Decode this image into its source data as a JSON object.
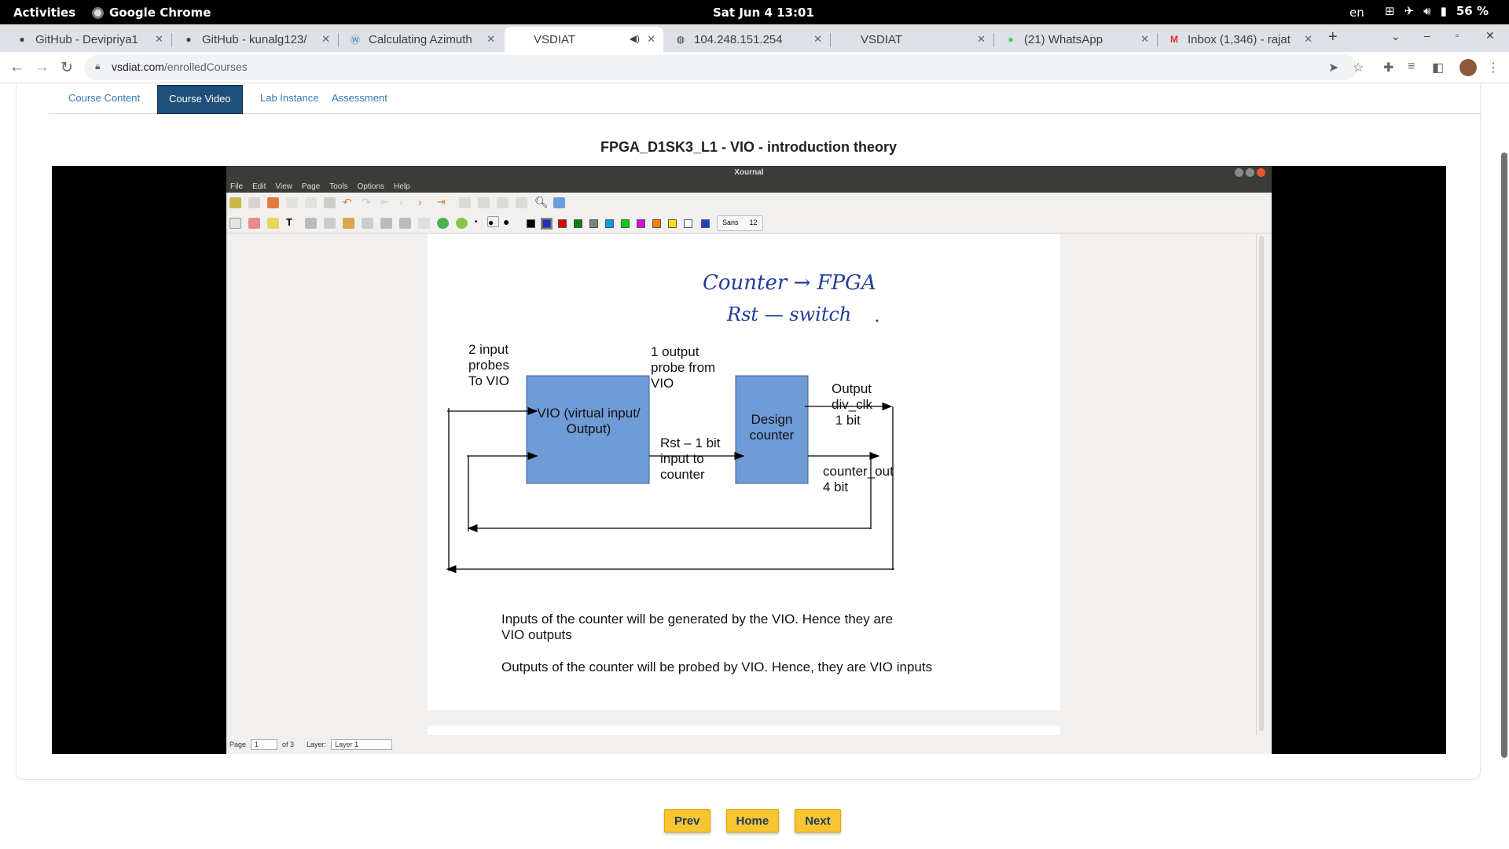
{
  "gnome": {
    "activities": "Activities",
    "app_name": "Google Chrome",
    "clock": "Sat Jun 4  13:01",
    "lang": "en",
    "battery": "56 %"
  },
  "tabs": [
    {
      "title": "GitHub - Devipriya1",
      "icon": "github-icon"
    },
    {
      "title": "GitHub - kunalg123/",
      "icon": "github-icon"
    },
    {
      "title": "Calculating Azimuth",
      "icon": "wordpress-icon"
    },
    {
      "title": "VSDIAT",
      "icon": "page-icon",
      "active": true
    },
    {
      "title": "104.248.151.254",
      "icon": "globe-icon"
    },
    {
      "title": "VSDIAT",
      "icon": "page-icon"
    },
    {
      "title": "(21) WhatsApp",
      "icon": "whatsapp-icon"
    },
    {
      "title": "Inbox (1,346) - rajat",
      "icon": "gmail-icon"
    }
  ],
  "address": {
    "host": "vsdiat.com",
    "path": "/enrolledCourses"
  },
  "page_tabs": [
    "Course Content",
    "Course Video",
    "Lab Instance",
    "Assessment"
  ],
  "lesson_title": "FPGA_D1SK3_L1 - VIO - introduction theory",
  "xournal": {
    "window_title": "Xournal",
    "menu": [
      "File",
      "Edit",
      "View",
      "Page",
      "Tools",
      "Options",
      "Help"
    ],
    "font_name": "Sans",
    "font_size": "12",
    "page_label": "Page",
    "page_value": "1",
    "page_of": "of 3",
    "layer_label": "Layer:",
    "layer_value": "Layer 1",
    "palette": [
      "#000000",
      "#2030c0",
      "#e00000",
      "#008000",
      "#808080",
      "#00a0e0",
      "#00d000",
      "#e000e0",
      "#ff8000",
      "#ffe000",
      "#ffffff",
      "#2040d0"
    ]
  },
  "slide": {
    "handwriting_line1": "Counter → FPGA",
    "handwriting_line2": "Rst — switch",
    "input_probes": [
      "2 input",
      "probes",
      "To VIO"
    ],
    "vio_box": [
      "VIO (virtual input/",
      "Output)"
    ],
    "output_probe": [
      "1 output",
      "probe from",
      "VIO"
    ],
    "rst_label": [
      "Rst – 1 bit",
      "input to",
      "counter"
    ],
    "design_box": [
      "Design",
      "counter"
    ],
    "output_div": [
      "Output",
      "div_clk",
      " 1 bit"
    ],
    "counter_out": [
      "counter_out",
      "4 bit"
    ],
    "para1_line1": "Inputs of the counter will be generated by the VIO. Hence they are",
    "para1_line2": "VIO outputs",
    "para2": "Outputs of the counter will be probed by VIO. Hence, they are VIO inputs"
  },
  "nav": {
    "prev": "Prev",
    "home": "Home",
    "next": "Next"
  },
  "colors": {
    "box_fill": "#6f9bd6",
    "active_tab": "#1f4e79",
    "nav_button": "#f7c432"
  }
}
